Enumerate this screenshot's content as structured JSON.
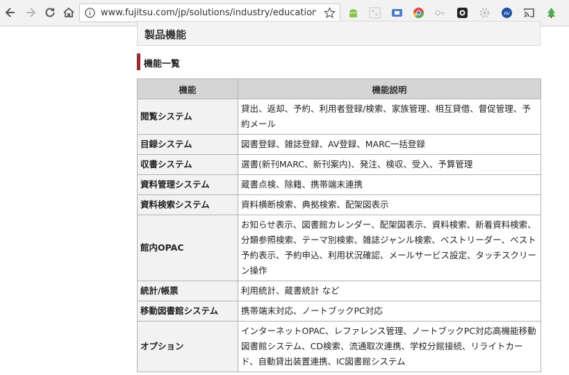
{
  "browser": {
    "url": "www.fujitsu.com/jp/solutions/industry/education/s"
  },
  "page": {
    "section_title": "製品機能",
    "subheading": "機能一覧",
    "table": {
      "headers": [
        "機能",
        "機能説明"
      ],
      "rows": [
        {
          "name": "閲覧システム",
          "desc": "貸出、返却、予約、利用者登録/検索、家族管理、相互貸借、督促管理、予約メール"
        },
        {
          "name": "目録システム",
          "desc": "図書登録、雑誌登録、AV登録、MARC一括登録"
        },
        {
          "name": "収書システム",
          "desc": "選書(新刊MARC、新刊案内)、発注、検収、受入、予算管理"
        },
        {
          "name": "資料管理システム",
          "desc": "蔵書点検、除籍、携帯端末連携"
        },
        {
          "name": "資料検索システム",
          "desc": "資料横断検索、典拠検索、配架図表示"
        },
        {
          "name": "館内OPAC",
          "desc": "お知らせ表示、図書館カレンダー、配架図表示、資料検索、新着資料検索、分類参照検索、テーマ別検索、雑誌ジャンル検索、ベストリーダー、ベスト予約表示、予約申込、利用状況確認、メールサービス設定、タッチスクリーン操作"
        },
        {
          "name": "統計/帳票",
          "desc": "利用統計、蔵書統計 など"
        },
        {
          "name": "移動図書館システム",
          "desc": "携帯端末対応、ノートブックPC対応"
        },
        {
          "name": "オプション",
          "desc": "インターネットOPAC、レファレンス管理、ノートブックPC対応高機能移動図書館システム、CD検索、流通取次連携、学校分館接続、リライトカード、自動貸出装置連携、IC図書館システム"
        }
      ]
    }
  },
  "colors": {
    "accent_bar": "#a5262a",
    "table_header_bg": "#d5d5d5",
    "row_label_bg": "#f2f2f2"
  },
  "icons": [
    "back-icon",
    "forward-icon",
    "reload-icon",
    "home-icon",
    "info-icon",
    "star-icon",
    "android-icon",
    "extension-grid-icon",
    "extension-icon",
    "chrome-color-icon",
    "key-icon",
    "camera-icon",
    "gear-icon",
    "av-icon",
    "cast-icon",
    "leaf-icon"
  ]
}
